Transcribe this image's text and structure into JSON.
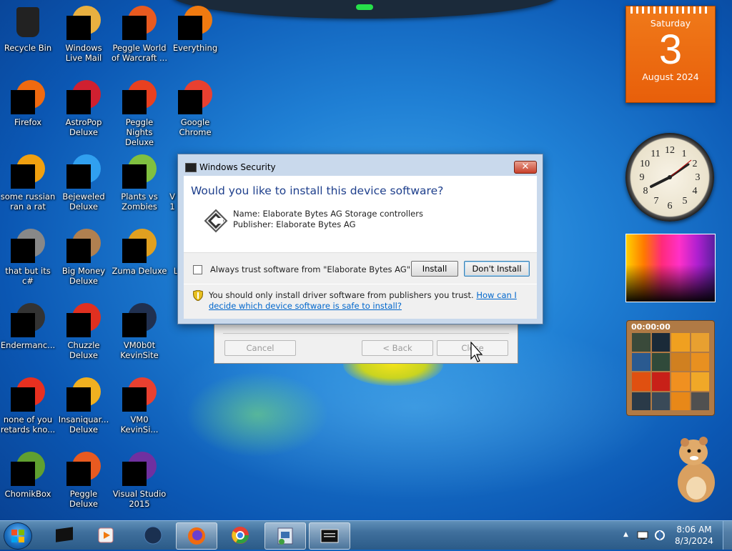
{
  "desktop_icons": [
    {
      "label": "Recycle Bin",
      "color": "#222222"
    },
    {
      "label": "Windows Live Mail",
      "color": "#e8b040"
    },
    {
      "label": "Peggle World of Warcraft ...",
      "color": "#e85a20"
    },
    {
      "label": "Everything",
      "color": "#f07a10"
    },
    {
      "label": "Firefox",
      "color": "#f06a10"
    },
    {
      "label": "AstroPop Deluxe",
      "color": "#d02030"
    },
    {
      "label": "Peggle Nights Deluxe",
      "color": "#e84020"
    },
    {
      "label": "Google Chrome",
      "color": "#e84030"
    },
    {
      "label": "some russian ran a rat",
      "color": "#f0a010"
    },
    {
      "label": "Bejeweled Deluxe",
      "color": "#30a0f0"
    },
    {
      "label": "Plants vs Zombies",
      "color": "#80c040"
    },
    {
      "label": "that but its c#",
      "color": "#888888"
    },
    {
      "label": "Big Money Deluxe",
      "color": "#b08050"
    },
    {
      "label": "Zuma Deluxe",
      "color": "#e0a020"
    },
    {
      "label": "Endermanc...",
      "color": "#333333"
    },
    {
      "label": "Chuzzle Deluxe",
      "color": "#e03020"
    },
    {
      "label": "VM0b0t KevinSite",
      "color": "#203050"
    },
    {
      "label": "none of you retards kno...",
      "color": "#e83020"
    },
    {
      "label": "Insaniquar... Deluxe",
      "color": "#f0b020"
    },
    {
      "label": "VM0 KevinSi...",
      "color": "#e84030"
    },
    {
      "label": "ChomikBox",
      "color": "#60a030"
    },
    {
      "label": "Peggle Deluxe",
      "color": "#e85a20"
    },
    {
      "label": "Visual Studio 2015",
      "color": "#7030a0"
    }
  ],
  "partial_labels": [
    "V",
    "1",
    "L"
  ],
  "calendar": {
    "day": "Saturday",
    "date": "3",
    "month": "August 2024"
  },
  "puzzle": {
    "timer": "00:00:00"
  },
  "dialog": {
    "title": "Windows Security",
    "close": "✕",
    "question": "Would you like to install this device software?",
    "name_line": "Name: Elaborate Bytes AG Storage controllers",
    "publisher_line": "Publisher: Elaborate Bytes AG",
    "trust_label": "Always trust software from \"Elaborate Bytes AG\".",
    "install_label": "Install",
    "dont_install_label": "Don't Install",
    "warning_text": "You should only install driver software from publishers you trust.",
    "help_link": "How can I decide which device software is safe to install?"
  },
  "wizard": {
    "cancel": "Cancel",
    "back": "< Back",
    "close": "Close"
  },
  "taskbar": {
    "time": "8:06 AM",
    "date": "8/3/2024",
    "tray_arrow": "▲"
  }
}
